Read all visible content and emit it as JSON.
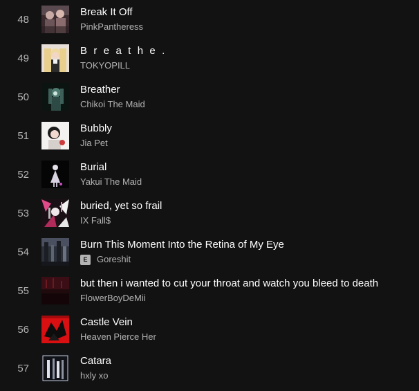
{
  "tracks": [
    {
      "number": "48",
      "title": "Break It Off",
      "artist": "PinkPantheress",
      "explicit": false,
      "cover": "cover-break-it-off"
    },
    {
      "number": "49",
      "title": "B r e a t h e .",
      "artist": "TOKYOPILL",
      "explicit": false,
      "cover": "cover-breathe"
    },
    {
      "number": "50",
      "title": "Breather",
      "artist": "Chikoi The Maid",
      "explicit": false,
      "cover": "cover-breather"
    },
    {
      "number": "51",
      "title": "Bubbly",
      "artist": "Jia Pet",
      "explicit": false,
      "cover": "cover-bubbly"
    },
    {
      "number": "52",
      "title": "Burial",
      "artist": "Yakui The Maid",
      "explicit": false,
      "cover": "cover-burial"
    },
    {
      "number": "53",
      "title": "buried, yet so frail",
      "artist": "IX Fall$",
      "explicit": false,
      "cover": "cover-buried-yet-so-frail"
    },
    {
      "number": "54",
      "title": "Burn This Moment Into the Retina of My Eye",
      "artist": "Goreshit",
      "explicit": true,
      "explicit_label": "E",
      "cover": "cover-burn-this-moment"
    },
    {
      "number": "55",
      "title": "but then i wanted to cut your throat and watch you bleed to death",
      "artist": "FlowerBoyDeMii",
      "explicit": false,
      "cover": "cover-but-then"
    },
    {
      "number": "56",
      "title": "Castle Vein",
      "artist": "Heaven Pierce Her",
      "explicit": false,
      "cover": "cover-castle-vein"
    },
    {
      "number": "57",
      "title": "Catara",
      "artist": "hxly xo",
      "explicit": false,
      "cover": "cover-catara"
    }
  ],
  "colors": {
    "background": "#121212",
    "title": "#ffffff",
    "secondary": "#b3b3b3"
  }
}
